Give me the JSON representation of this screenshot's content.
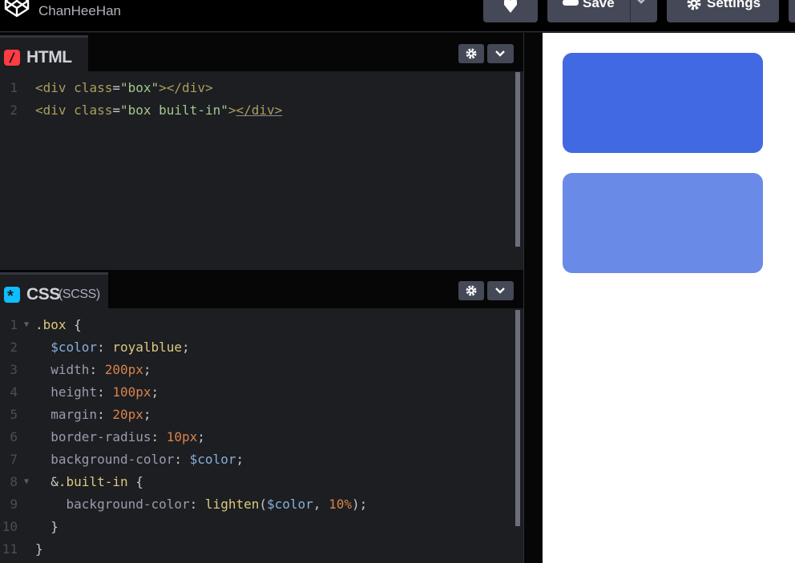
{
  "topbar": {
    "username": "ChanHeeHan",
    "save_label": "Save",
    "settings_label": "Settings"
  },
  "html_pane": {
    "title": "HTML",
    "lines": [
      {
        "n": "1",
        "parts": [
          [
            "tag",
            "<div "
          ],
          [
            "attr",
            "class"
          ],
          [
            "pun",
            "="
          ],
          [
            "str",
            "\"box\""
          ],
          [
            "tag",
            "></div>"
          ]
        ]
      },
      {
        "n": "2",
        "parts": [
          [
            "tag",
            "<div "
          ],
          [
            "attr",
            "class"
          ],
          [
            "pun",
            "="
          ],
          [
            "str",
            "\"box built-in\""
          ],
          [
            "tag",
            ">"
          ],
          [
            "tag u",
            "</div>"
          ]
        ]
      }
    ]
  },
  "css_pane": {
    "title": "CSS",
    "subtitle": "(SCSS)",
    "lines": [
      {
        "n": "1",
        "fold": true,
        "parts": [
          [
            "sel",
            ".box"
          ],
          [
            "pun",
            " {"
          ]
        ]
      },
      {
        "n": "2",
        "parts": [
          [
            "pun",
            "  "
          ],
          [
            "var",
            "$color"
          ],
          [
            "pun",
            ": "
          ],
          [
            "sel",
            "royalblue"
          ],
          [
            "pun",
            ";"
          ]
        ]
      },
      {
        "n": "3",
        "parts": [
          [
            "pun",
            "  "
          ],
          [
            "prop",
            "width"
          ],
          [
            "pun",
            ": "
          ],
          [
            "num",
            "200px"
          ],
          [
            "pun",
            ";"
          ]
        ]
      },
      {
        "n": "4",
        "parts": [
          [
            "pun",
            "  "
          ],
          [
            "prop",
            "height"
          ],
          [
            "pun",
            ": "
          ],
          [
            "num",
            "100px"
          ],
          [
            "pun",
            ";"
          ]
        ]
      },
      {
        "n": "5",
        "parts": [
          [
            "pun",
            "  "
          ],
          [
            "prop",
            "margin"
          ],
          [
            "pun",
            ": "
          ],
          [
            "num",
            "20px"
          ],
          [
            "pun",
            ";"
          ]
        ]
      },
      {
        "n": "6",
        "parts": [
          [
            "pun",
            "  "
          ],
          [
            "prop",
            "border-radius"
          ],
          [
            "pun",
            ": "
          ],
          [
            "num",
            "10px"
          ],
          [
            "pun",
            ";"
          ]
        ]
      },
      {
        "n": "7",
        "parts": [
          [
            "pun",
            "  "
          ],
          [
            "prop",
            "background-color"
          ],
          [
            "pun",
            ": "
          ],
          [
            "var",
            "$color"
          ],
          [
            "pun",
            ";"
          ]
        ]
      },
      {
        "n": "8",
        "fold": true,
        "parts": [
          [
            "pun",
            "  &"
          ],
          [
            "sel",
            ".built-in"
          ],
          [
            "pun",
            " {"
          ]
        ]
      },
      {
        "n": "9",
        "parts": [
          [
            "pun",
            "    "
          ],
          [
            "prop",
            "background-color"
          ],
          [
            "pun",
            ": "
          ],
          [
            "fn",
            "lighten"
          ],
          [
            "pun",
            "("
          ],
          [
            "var",
            "$color"
          ],
          [
            "pun",
            ", "
          ],
          [
            "num",
            "10%"
          ],
          [
            "pun",
            ");"
          ]
        ]
      },
      {
        "n": "10",
        "parts": [
          [
            "pun",
            "  }"
          ]
        ]
      },
      {
        "n": "11",
        "parts": [
          [
            "pun",
            "}"
          ]
        ]
      }
    ]
  },
  "preview": {
    "box_color": "#4169e1",
    "box_builtin_color": "#6a8ae7"
  }
}
